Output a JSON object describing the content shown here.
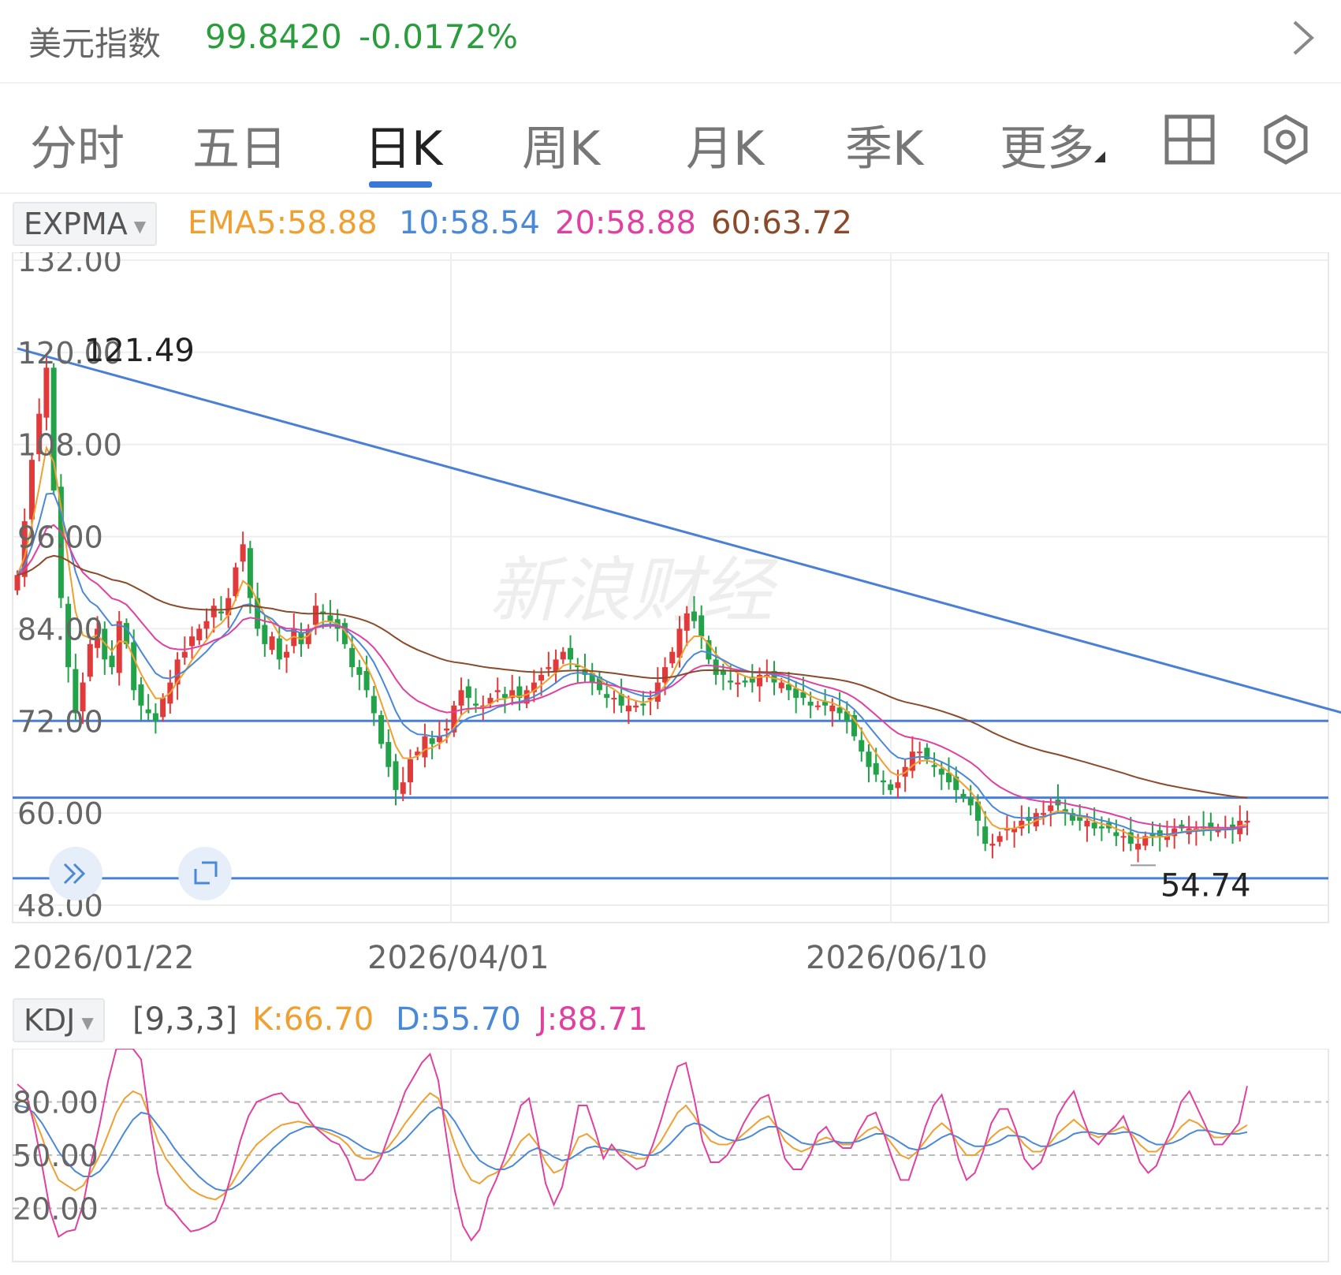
{
  "header": {
    "name": "美元指数",
    "price": "99.8420",
    "change": "-0.0172%"
  },
  "tabs": [
    {
      "label": "分时",
      "active": false
    },
    {
      "label": "五日",
      "active": false
    },
    {
      "label": "日K",
      "active": true
    },
    {
      "label": "周K",
      "active": false
    },
    {
      "label": "月K",
      "active": false
    },
    {
      "label": "季K",
      "active": false
    },
    {
      "label": "更多",
      "active": false
    }
  ],
  "main_indicator": {
    "name": "EXPMA",
    "values": [
      {
        "label": "EMA5:58.88",
        "color": "#f0a030"
      },
      {
        "label": "10:58.54",
        "color": "#4a88d8"
      },
      {
        "label": "20:58.88",
        "color": "#e040a0"
      },
      {
        "label": "60:63.72",
        "color": "#8b4a2a"
      }
    ]
  },
  "sub_indicator": {
    "name": "KDJ",
    "params": "[9,3,3]",
    "values": [
      {
        "label": "K:66.70",
        "color": "#f0a030"
      },
      {
        "label": "D:55.70",
        "color": "#4a88d8"
      },
      {
        "label": "J:88.71",
        "color": "#e040a0"
      }
    ]
  },
  "watermark": "新浪财经",
  "colors": {
    "up": "#e03a3a",
    "down": "#22a34a",
    "trendline": "#4a7fd8",
    "grid": "#eeeeee"
  },
  "chart_data": [
    {
      "type": "candlestick",
      "y_ticks": [
        "132.00",
        "120.00",
        "108.00",
        "96.00",
        "84.00",
        "72.00",
        "60.00",
        "48.00"
      ],
      "ylim": [
        48,
        132
      ],
      "x_labels": [
        "2026/01/22",
        "2026/04/01",
        "2026/06/10"
      ],
      "max_label": "121.49",
      "min_label": "54.74",
      "horizontal_lines": [
        72,
        62,
        51.5
      ],
      "trendline": [
        [
          0,
          120.5
        ],
        [
          213,
          65
        ]
      ],
      "close": [
        91,
        98,
        106,
        112,
        118,
        102,
        88,
        79,
        73,
        77,
        82,
        84,
        80,
        79,
        85,
        82,
        76,
        74,
        73,
        72,
        75,
        77,
        80,
        81,
        83,
        84,
        85,
        87,
        86,
        88,
        92,
        95,
        88,
        84,
        82,
        83,
        80,
        81,
        84,
        82,
        84,
        87,
        86,
        85,
        84,
        82,
        79,
        78,
        76,
        73,
        69,
        66,
        63,
        64,
        67,
        68,
        70,
        69,
        70,
        71,
        74,
        76,
        75,
        74,
        74,
        75,
        76,
        75,
        76,
        75,
        76,
        77,
        78,
        79,
        80,
        81,
        80,
        79,
        78,
        77,
        76,
        75,
        75,
        74,
        74,
        74,
        74,
        75,
        77,
        79,
        81,
        84,
        86,
        85,
        83,
        80,
        78,
        78,
        77,
        77,
        77,
        77,
        78,
        78,
        77,
        77,
        76,
        75,
        75,
        74,
        74,
        74,
        74,
        73,
        72,
        70,
        68,
        66,
        65,
        64,
        63,
        64,
        66,
        68,
        68,
        67,
        66,
        65,
        64,
        63,
        62,
        61,
        59,
        56,
        56,
        57,
        58,
        58,
        59,
        59,
        60,
        60,
        61,
        61,
        60,
        59,
        59,
        59,
        58,
        58,
        58,
        57,
        57,
        56,
        56,
        57,
        57,
        57,
        57,
        58,
        58,
        58,
        58,
        58,
        58,
        58,
        58,
        58,
        59,
        59
      ],
      "series_values": [
        {
          "name": "EMA5",
          "value": 58.88
        },
        {
          "name": "EMA10",
          "value": 58.54
        },
        {
          "name": "EMA20",
          "value": 58.88
        },
        {
          "name": "EMA60",
          "value": 63.72
        }
      ]
    },
    {
      "type": "line",
      "y_ticks": [
        "80.00",
        "50.00",
        "20.00"
      ],
      "ylim": [
        -10,
        110
      ],
      "series": [
        {
          "name": "K",
          "values": [
            82,
            80,
            72,
            60,
            46,
            36,
            33,
            30,
            33,
            41,
            50,
            62,
            74,
            82,
            86,
            84,
            72,
            58,
            48,
            42,
            36,
            31,
            28,
            26,
            25,
            28,
            34,
            42,
            50,
            56,
            60,
            64,
            67,
            68,
            69,
            68,
            66,
            64,
            62,
            60,
            56,
            50,
            48,
            48,
            50,
            55,
            61,
            68,
            74,
            80,
            85,
            82,
            70,
            56,
            44,
            36,
            34,
            38,
            40,
            44,
            50,
            58,
            62,
            56,
            46,
            40,
            42,
            50,
            60,
            62,
            58,
            52,
            54,
            52,
            50,
            48,
            48,
            52,
            58,
            66,
            74,
            78,
            72,
            64,
            58,
            56,
            56,
            58,
            62,
            66,
            70,
            72,
            66,
            58,
            54,
            52,
            54,
            58,
            60,
            58,
            56,
            56,
            60,
            64,
            66,
            62,
            56,
            50,
            48,
            52,
            58,
            64,
            68,
            64,
            56,
            50,
            50,
            54,
            60,
            64,
            66,
            62,
            56,
            52,
            52,
            56,
            62,
            66,
            70,
            66,
            62,
            60,
            62,
            64,
            66,
            62,
            56,
            52,
            52,
            56,
            60,
            66,
            70,
            68,
            64,
            60,
            60,
            62,
            64,
            67
          ]
        },
        {
          "name": "D",
          "values": [
            78,
            77,
            74,
            68,
            60,
            52,
            46,
            41,
            38,
            38,
            41,
            47,
            55,
            63,
            70,
            74,
            73,
            67,
            61,
            54,
            48,
            43,
            38,
            34,
            31,
            30,
            31,
            34,
            39,
            44,
            49,
            54,
            58,
            62,
            64,
            66,
            66,
            65,
            64,
            62,
            60,
            57,
            54,
            52,
            51,
            52,
            55,
            59,
            64,
            69,
            74,
            77,
            75,
            69,
            61,
            53,
            47,
            44,
            42,
            42,
            44,
            48,
            52,
            54,
            52,
            49,
            47,
            48,
            51,
            54,
            55,
            54,
            53,
            53,
            52,
            51,
            50,
            50,
            52,
            56,
            61,
            66,
            68,
            67,
            64,
            61,
            59,
            58,
            59,
            61,
            64,
            66,
            66,
            63,
            60,
            57,
            56,
            56,
            57,
            58,
            57,
            57,
            58,
            60,
            62,
            62,
            60,
            57,
            54,
            53,
            54,
            57,
            60,
            62,
            60,
            57,
            55,
            55,
            56,
            58,
            61,
            61,
            60,
            57,
            55,
            55,
            57,
            59,
            62,
            63,
            63,
            62,
            62,
            62,
            63,
            63,
            61,
            58,
            56,
            56,
            57,
            59,
            62,
            64,
            64,
            63,
            62,
            62,
            62,
            63
          ]
        },
        {
          "name": "J",
          "values": [
            90,
            86,
            68,
            44,
            18,
            4,
            7,
            8,
            23,
            47,
            68,
            92,
            112,
            120,
            118,
            104,
            70,
            40,
            22,
            18,
            12,
            7,
            8,
            10,
            13,
            24,
            40,
            58,
            72,
            80,
            82,
            84,
            85,
            80,
            79,
            72,
            66,
            62,
            58,
            56,
            48,
            36,
            36,
            40,
            48,
            61,
            73,
            86,
            94,
            102,
            107,
            92,
            60,
            30,
            10,
            2,
            8,
            26,
            36,
            48,
            62,
            78,
            82,
            60,
            34,
            22,
            32,
            54,
            78,
            78,
            64,
            48,
            56,
            50,
            46,
            42,
            44,
            56,
            70,
            86,
            100,
            102,
            82,
            58,
            46,
            46,
            50,
            58,
            68,
            76,
            82,
            84,
            66,
            48,
            42,
            42,
            50,
            62,
            66,
            58,
            54,
            54,
            64,
            72,
            74,
            62,
            48,
            36,
            36,
            50,
            66,
            78,
            84,
            68,
            48,
            36,
            40,
            52,
            68,
            76,
            76,
            64,
            48,
            42,
            46,
            58,
            72,
            80,
            86,
            72,
            60,
            56,
            62,
            66,
            72,
            60,
            46,
            40,
            44,
            56,
            66,
            80,
            86,
            76,
            66,
            56,
            56,
            62,
            68,
            89
          ]
        }
      ]
    }
  ]
}
